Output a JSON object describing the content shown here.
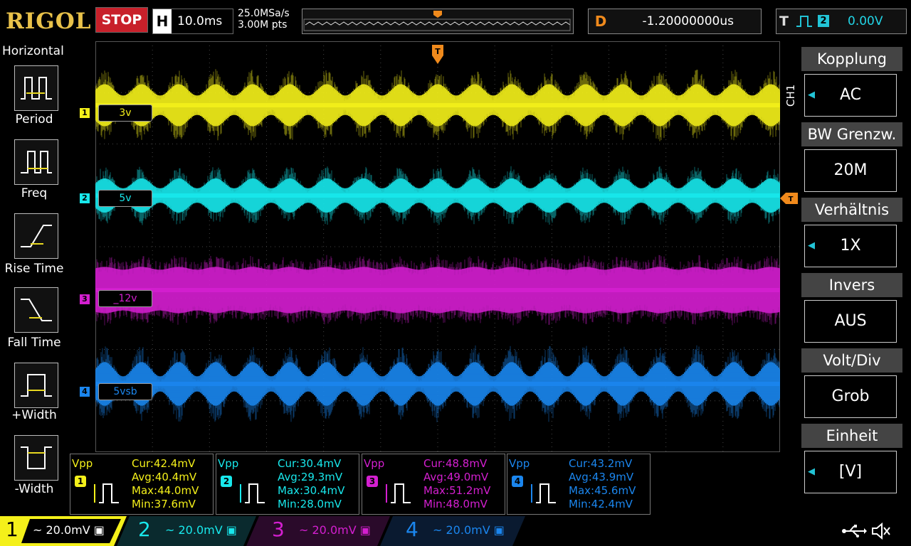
{
  "brand": "RIGOL",
  "run_state": "STOP",
  "horizontal": {
    "letter": "H",
    "timebase": "10.0ms"
  },
  "acquisition": {
    "sample_rate": "25.0MSa/s",
    "memory_depth": "3.00M pts"
  },
  "delay": {
    "letter": "D",
    "value": "-1.20000000us"
  },
  "trigger": {
    "letter": "T",
    "source": "2",
    "level": "0.00V"
  },
  "left_menu": {
    "title": "Horizontal",
    "items": [
      {
        "label": "Period"
      },
      {
        "label": "Freq"
      },
      {
        "label": "Rise Time"
      },
      {
        "label": "Fall Time"
      },
      {
        "label": "+Width"
      },
      {
        "label": "-Width"
      }
    ]
  },
  "channels": [
    {
      "num": "1",
      "label": "3v",
      "color": "#f4f01a"
    },
    {
      "num": "2",
      "label": "5v",
      "color": "#18e8ec"
    },
    {
      "num": "3",
      "label": "_12v",
      "color": "#d41fd0"
    },
    {
      "num": "4",
      "label": "5vsb",
      "color": "#1b86ee"
    }
  ],
  "right_menu": {
    "channel_tag": "CH1",
    "items": [
      {
        "title": "Kopplung",
        "value": "AC",
        "arrow": true
      },
      {
        "title": "BW Grenzw.",
        "value": "20M",
        "arrow": false
      },
      {
        "title": "Verhältnis",
        "value": "1X",
        "arrow": true
      },
      {
        "title": "Invers",
        "value": "AUS",
        "arrow": false
      },
      {
        "title": "Volt/Div",
        "value": "Grob",
        "arrow": false
      },
      {
        "title": "Einheit",
        "value": "[V]",
        "arrow": true
      }
    ]
  },
  "measurements": [
    {
      "type": "Vpp",
      "num": "1",
      "cur": "Cur:42.4mV",
      "avg": "Avg:40.4mV",
      "max": "Max:44.0mV",
      "min": "Min:37.6mV"
    },
    {
      "type": "Vpp",
      "num": "2",
      "cur": "Cur:30.4mV",
      "avg": "Avg:29.3mV",
      "max": "Max:30.4mV",
      "min": "Min:28.0mV"
    },
    {
      "type": "Vpp",
      "num": "3",
      "cur": "Cur:48.8mV",
      "avg": "Avg:49.0mV",
      "max": "Max:51.2mV",
      "min": "Min:48.0mV"
    },
    {
      "type": "Vpp",
      "num": "4",
      "cur": "Cur:43.2mV",
      "avg": "Avg:43.9mV",
      "max": "Max:45.6mV",
      "min": "Min:42.4mV"
    }
  ],
  "bottom_channels": [
    {
      "num": "1",
      "scale": "20.0mV"
    },
    {
      "num": "2",
      "scale": "20.0mV"
    },
    {
      "num": "3",
      "scale": "20.0mV"
    },
    {
      "num": "4",
      "scale": "20.0mV"
    }
  ],
  "status_icons": [
    "usb-icon",
    "speaker-muted-icon"
  ]
}
